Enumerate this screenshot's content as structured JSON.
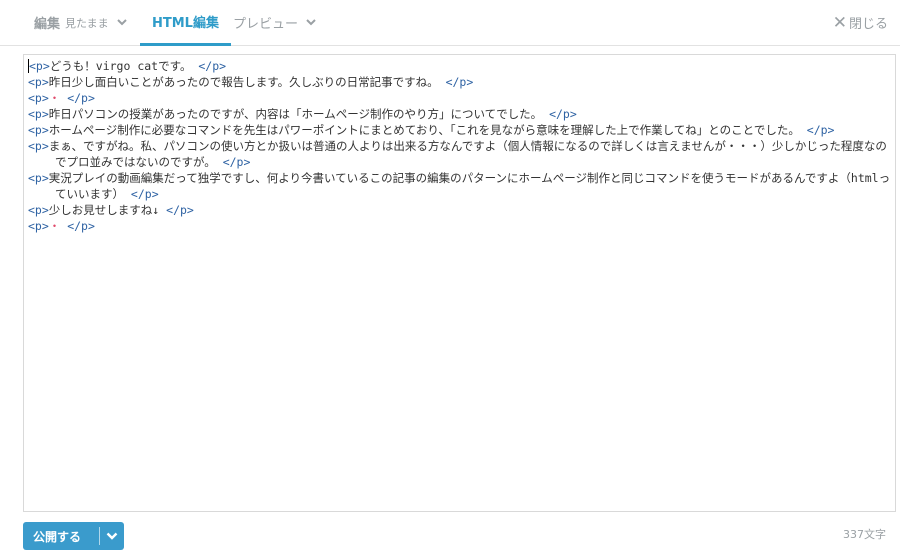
{
  "tabs": {
    "edit": {
      "label": "編集",
      "sub": "見たまま"
    },
    "html": {
      "label": "HTML編集"
    },
    "preview": {
      "label": "プレビュー"
    }
  },
  "close_label": "閉じる",
  "publish_label": "公開する",
  "char_count": "337文字",
  "accent_color": "#3a9bcc",
  "lines": [
    {
      "open": "<p>",
      "text": "どうも！virgo catです。",
      "close": "</p>"
    },
    {
      "open": "<p>",
      "text": "昨日少し面白いことがあったので報告します。久しぶりの日常記事ですね。",
      "close": "</p>"
    },
    {
      "open": "<p>",
      "text": "・",
      "close": "</p>"
    },
    {
      "open": "<p>",
      "text": "昨日パソコンの授業があったのですが、内容は「ホームページ制作のやり方」についてでした。",
      "close": "</p>"
    },
    {
      "open": "<p>",
      "text": "ホームページ制作に必要なコマンドを先生はパワーポイントにまとめており、「これを見ながら意味を理解した上で作業してね」とのことでした。",
      "close": "</p>"
    },
    {
      "open": "<p>",
      "text": "まぁ、ですがね。私、パソコンの使い方とか扱いは普通の人よりは出来る方なんですよ（個人情報になるので詳しくは言えませんが・・・）少しかじった程度なのでプロ並みではないのですが。",
      "close": "</p>"
    },
    {
      "open": "<p>",
      "text": "実況プレイの動画編集だって独学ですし、何より今書いているこの記事の編集のパターンにホームページ制作と同じコマンドを使うモードがあるんですよ（htmlっていいます）",
      "close": "</p>"
    },
    {
      "open": "<p>",
      "text": "少しお見せしますね↓",
      "close": "</p>"
    },
    {
      "open": "<p>",
      "text": "・",
      "close": "</p>"
    }
  ]
}
